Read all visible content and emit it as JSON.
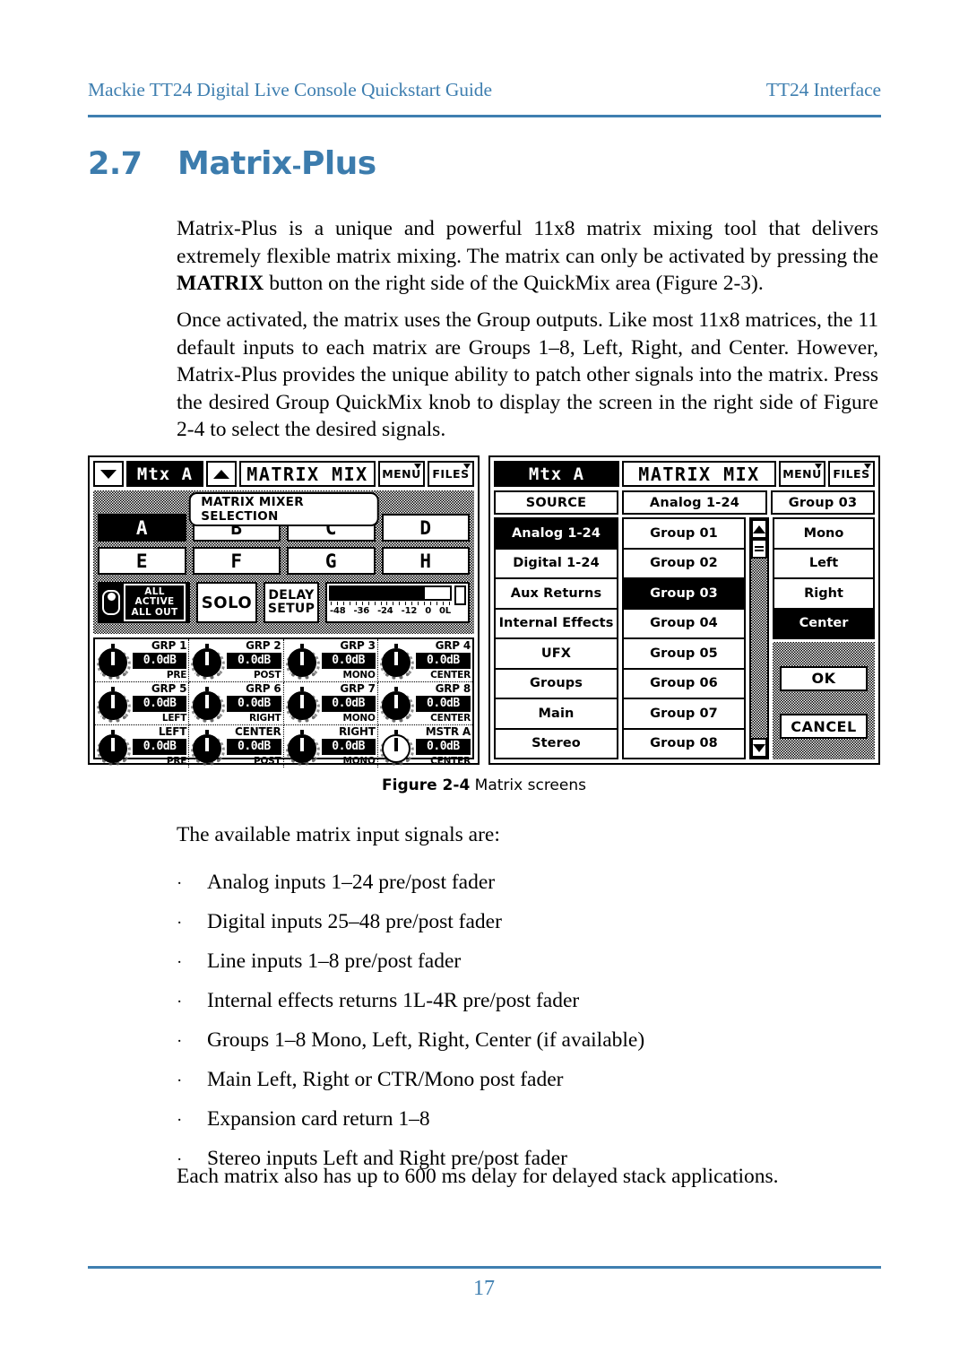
{
  "runhead": {
    "left": "Mackie TT24 Digital  Live Console Quickstart Guide",
    "right": "TT24 Interface"
  },
  "section": {
    "number": "2.7",
    "title_a": "Matrix",
    "hyphen": "-",
    "title_b": "Plus"
  },
  "paragraphs": {
    "p1_a": "Matrix-Plus is a unique and powerful 11x8 matrix mixing tool that delivers extremely flexible matrix mixing. The matrix can only be activated by pressing the ",
    "p1_b": "MATRIX",
    "p1_c": " button on the right side of the QuickMix area (Figure 2-3).",
    "p2": "Once activated, the matrix uses the Group outputs. Like most 11x8 matrices, the 11 default inputs to each matrix are Groups 1–8, Left, Right, and Center. However, Matrix-Plus provides the unique ability to patch other signals into the matrix. Press the desired Group QuickMix knob to display the screen in the right side of Figure 2-4 to select the desired signals.",
    "p3": "The available matrix input signals are:",
    "p4": "Each matrix also has up to 600 ms delay for delayed stack applications."
  },
  "bullets": [
    "Analog inputs 1–24 pre/post fader",
    "Digital inputs 25–48 pre/post fader",
    "Line inputs 1–8 pre/post fader",
    "Internal effects returns 1L-4R pre/post fader",
    "Groups 1–8 Mono, Left, Right, Center (if available)",
    "Main Left, Right or CTR/Mono post fader",
    "Expansion card return 1–8",
    "Stereo inputs Left and Right pre/post fader"
  ],
  "bullet_marker": "·",
  "figure": {
    "caption_bold": "Figure 2-4",
    "caption_rest": " Matrix screens"
  },
  "footer": {
    "page_number": "17"
  },
  "colors": {
    "accent_blue": "#3F7FB0",
    "heading_blue": "#3C7CAD",
    "lcd_black": "#000000",
    "lcd_white": "#ffffff"
  },
  "left_screen": {
    "titlebar": {
      "down_arrow": "▼",
      "mtx_label": "Mtx A",
      "up_arrow": "▲",
      "screen_title": "MATRIX MIX",
      "menu_label": "MENU",
      "files_label": "FILES"
    },
    "selection_panel_title": "MATRIX MIXER SELECTION",
    "matrix_buttons": [
      {
        "label": "A",
        "selected": true
      },
      {
        "label": "B",
        "selected": false
      },
      {
        "label": "C",
        "selected": false
      },
      {
        "label": "D",
        "selected": false
      },
      {
        "label": "E",
        "selected": false
      },
      {
        "label": "F",
        "selected": false
      },
      {
        "label": "G",
        "selected": false
      },
      {
        "label": "H",
        "selected": false
      }
    ],
    "all_active_line1": "ALL ACTIVE",
    "all_active_line2": "ALL OUT",
    "solo_label": "SOLO",
    "delay_line1": "DELAY",
    "delay_line2": "SETUP",
    "meter": {
      "level_percent": 79,
      "scale": [
        "-48",
        "-36",
        "-24",
        "-12",
        "0",
        "0L"
      ]
    },
    "knobs": [
      {
        "name": "GRP 1",
        "value": "0.0dB",
        "tag": "PRE",
        "hollow": false
      },
      {
        "name": "GRP 2",
        "value": "0.0dB",
        "tag": "POST",
        "hollow": false
      },
      {
        "name": "GRP 3",
        "value": "0.0dB",
        "tag": "MONO",
        "hollow": false
      },
      {
        "name": "GRP 4",
        "value": "0.0dB",
        "tag": "CENTER",
        "hollow": false
      },
      {
        "name": "GRP 5",
        "value": "0.0dB",
        "tag": "LEFT",
        "hollow": false
      },
      {
        "name": "GRP 6",
        "value": "0.0dB",
        "tag": "RIGHT",
        "hollow": false
      },
      {
        "name": "GRP 7",
        "value": "0.0dB",
        "tag": "MONO",
        "hollow": false
      },
      {
        "name": "GRP 8",
        "value": "0.0dB",
        "tag": "CENTER",
        "hollow": false
      },
      {
        "name": "LEFT",
        "value": "0.0dB",
        "tag": "PRE",
        "hollow": false
      },
      {
        "name": "CENTER",
        "value": "0.0dB",
        "tag": "POST",
        "hollow": false
      },
      {
        "name": "RIGHT",
        "value": "0.0dB",
        "tag": "MONO",
        "hollow": false
      },
      {
        "name": "MSTR A",
        "value": "0.0dB",
        "tag": "CENTER",
        "hollow": true
      }
    ]
  },
  "right_screen": {
    "titlebar": {
      "mtx_label": "Mtx A",
      "screen_title": "MATRIX MIX",
      "menu_label": "MENU",
      "files_label": "FILES"
    },
    "column_headers": {
      "source": "SOURCE",
      "group": "Analog 1-24",
      "dest": "Group 03"
    },
    "source_items": [
      {
        "label": "Analog 1-24",
        "selected": true
      },
      {
        "label": "Digital  1-24",
        "selected": false
      },
      {
        "label": "Aux Returns",
        "selected": false
      },
      {
        "label": "Internal Effects",
        "selected": false
      },
      {
        "label": "UFX",
        "selected": false
      },
      {
        "label": "Groups",
        "selected": false
      },
      {
        "label": "Main",
        "selected": false
      },
      {
        "label": "Stereo",
        "selected": false
      }
    ],
    "group_items": [
      {
        "label": "Group 01",
        "selected": false
      },
      {
        "label": "Group 02",
        "selected": false
      },
      {
        "label": "Group 03",
        "selected": true
      },
      {
        "label": "Group 04",
        "selected": false
      },
      {
        "label": "Group 05",
        "selected": false
      },
      {
        "label": "Group 06",
        "selected": false
      },
      {
        "label": "Group 07",
        "selected": false
      },
      {
        "label": "Group 08",
        "selected": false
      }
    ],
    "dest_items": [
      {
        "label": "Mono",
        "selected": false
      },
      {
        "label": "Left",
        "selected": false
      },
      {
        "label": "Right",
        "selected": false
      },
      {
        "label": "Center",
        "selected": true
      }
    ],
    "ok_label": "OK",
    "cancel_label": "CANCEL"
  }
}
